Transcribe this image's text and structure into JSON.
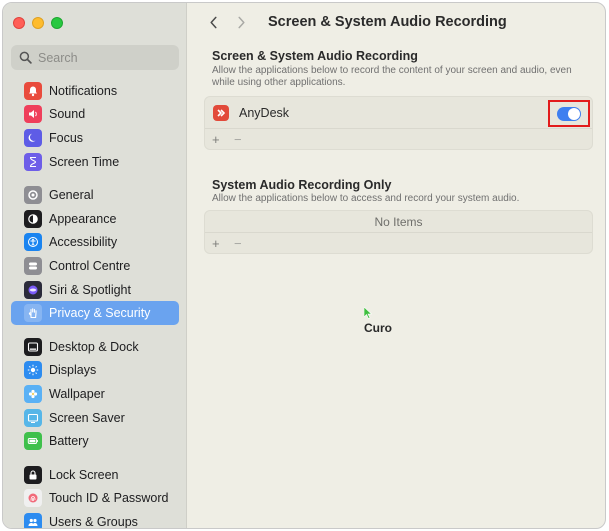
{
  "window": {
    "controls": [
      "close",
      "minimize",
      "zoom"
    ]
  },
  "sidebar": {
    "search": {
      "placeholder": "Search",
      "value": ""
    },
    "groups": [
      [
        {
          "label": "Notifications",
          "icon": "bell-icon",
          "color": "#e94b3c"
        },
        {
          "label": "Sound",
          "icon": "speaker-icon",
          "color": "#ef3f5b"
        },
        {
          "label": "Focus",
          "icon": "moon-icon",
          "color": "#5e5ce6"
        },
        {
          "label": "Screen Time",
          "icon": "hourglass-icon",
          "color": "#6e5ee8"
        }
      ],
      [
        {
          "label": "General",
          "icon": "gear-icon",
          "color": "#8e8e93"
        },
        {
          "label": "Appearance",
          "icon": "appearance-icon",
          "color": "#1d1d1f"
        },
        {
          "label": "Accessibility",
          "icon": "accessibility-icon",
          "color": "#1a84f0"
        },
        {
          "label": "Control Centre",
          "icon": "control-centre-icon",
          "color": "#8e8e93"
        },
        {
          "label": "Siri & Spotlight",
          "icon": "siri-icon",
          "color": "#2b2b3a"
        },
        {
          "label": "Privacy & Security",
          "icon": "hand-icon",
          "color": "#3f82ef",
          "active": true
        }
      ],
      [
        {
          "label": "Desktop & Dock",
          "icon": "dock-icon",
          "color": "#1d1d1f"
        },
        {
          "label": "Displays",
          "icon": "sun-icon",
          "color": "#2d8cf0"
        },
        {
          "label": "Wallpaper",
          "icon": "flower-icon",
          "color": "#5ab1f5"
        },
        {
          "label": "Screen Saver",
          "icon": "screen-saver-icon",
          "color": "#56b6e8"
        },
        {
          "label": "Battery",
          "icon": "battery-icon",
          "color": "#3fc04b"
        }
      ],
      [
        {
          "label": "Lock Screen",
          "icon": "lock-icon",
          "color": "#1d1d1f"
        },
        {
          "label": "Touch ID & Password",
          "icon": "fingerprint-icon",
          "color": "#f0f0f0"
        },
        {
          "label": "Users & Groups",
          "icon": "users-icon",
          "color": "#2d8cf0"
        }
      ]
    ]
  },
  "main": {
    "title": "Screen & System Audio Recording",
    "section1": {
      "title": "Screen & System Audio Recording",
      "description": "Allow the applications below to record the content of your screen and audio, even while using other applications.",
      "apps": [
        {
          "name": "AnyDesk",
          "icon": "anydesk-icon",
          "enabled": true
        }
      ],
      "add_label": "+",
      "remove_label": "−"
    },
    "section2": {
      "title": "System Audio Recording Only",
      "description": "Allow the applications below to access and record your system audio.",
      "empty_text": "No Items",
      "add_label": "+",
      "remove_label": "−"
    },
    "caption": "Curo"
  }
}
